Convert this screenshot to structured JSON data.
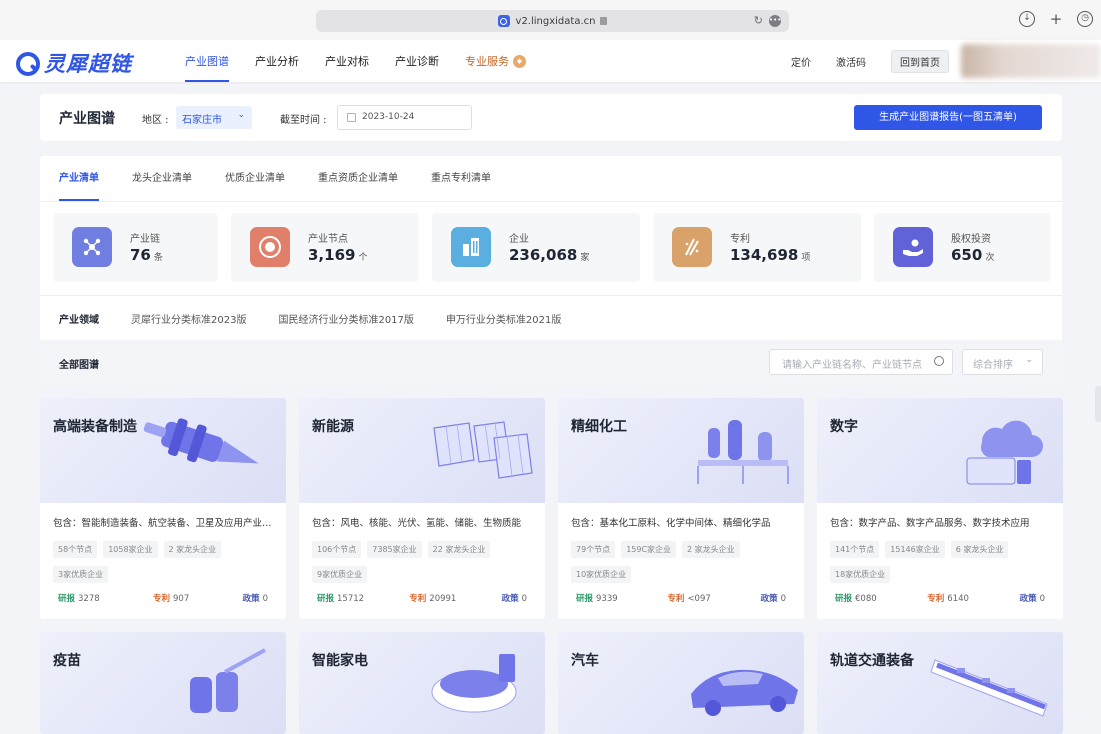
{
  "browser": {
    "url": "v2.lingxidata.cn"
  },
  "header": {
    "logo_text": "灵犀超链",
    "nav": [
      {
        "label": "产业图谱",
        "active": true
      },
      {
        "label": "产业分析"
      },
      {
        "label": "产业对标"
      },
      {
        "label": "产业诊断"
      },
      {
        "label": "专业服务",
        "special": true
      }
    ],
    "right_links": [
      "定价",
      "激活码"
    ],
    "home_button": "回到首页"
  },
  "filter": {
    "title": "产业图谱",
    "region_label": "地区 :",
    "region_value": "石家庄市",
    "date_label": "截至时间 :",
    "date_value": "2023-10-24",
    "generate_button": "生成产业图谱报告(一图五清单)"
  },
  "tabs": [
    "产业清单",
    "龙头企业清单",
    "优质企业清单",
    "重点资质企业清单",
    "重点专利清单"
  ],
  "stats": [
    {
      "label": "产业链",
      "value": "76",
      "unit": "条",
      "icon": "network-icon",
      "color": "#6f7ee0"
    },
    {
      "label": "产业节点",
      "value": "3,169",
      "unit": "个",
      "icon": "target-icon",
      "color": "#e0806a"
    },
    {
      "label": "企业",
      "value": "236,068",
      "unit": "家",
      "icon": "building-icon",
      "color": "#5aaee0"
    },
    {
      "label": "专利",
      "value": "134,698",
      "unit": "项",
      "icon": "patent-icon",
      "color": "#d8a26a"
    },
    {
      "label": "股权投资",
      "value": "650",
      "unit": "次",
      "icon": "investment-icon",
      "color": "#6262d8"
    }
  ],
  "domain_tabs": [
    "产业领域",
    "灵犀行业分类标准2023版",
    "国民经济行业分类标准2017版",
    "申万行业分类标准2021版"
  ],
  "all_bar": {
    "title": "全部图谱",
    "search_placeholder": "请输入产业链名称、产业链节点",
    "sort_label": "综合排序"
  },
  "metric_labels": {
    "research": "研报",
    "patent": "专利",
    "policy": "政策"
  },
  "cards": [
    {
      "name": "高端装备制造",
      "desc": "包含：智能制造装备、航空装备、卫星及应用产业、轨道交通装备、海洋工程装备",
      "tags": [
        "58个节点",
        "1058家企业",
        "2 家龙头企业",
        "3家优质企业"
      ],
      "research": "3278",
      "patent": "907",
      "policy": "0",
      "art": "drill"
    },
    {
      "name": "新能源",
      "desc": "包含：风电、核能、光伏、氢能、储能、生物质能",
      "tags": [
        "106个节点",
        "7385家企业",
        "22 家龙头企业",
        "9家优质企业"
      ],
      "research": "15712",
      "patent": "20991",
      "policy": "0",
      "art": "solar"
    },
    {
      "name": "精细化工",
      "desc": "包含：基本化工原料、化学中间体、精细化学品",
      "tags": [
        "79个节点",
        "159C家企业",
        "2 家龙头企业",
        "10家优质企业"
      ],
      "research": "9339",
      "patent": "<097",
      "policy": "0",
      "art": "chem"
    },
    {
      "name": "数字",
      "desc": "包含：数字产品、数字产品服务、数字技术应用",
      "tags": [
        "141个节点",
        "15146家企业",
        "6 家龙头企业",
        "18家优质企业"
      ],
      "research": "€080",
      "patent": "6140",
      "policy": "0",
      "art": "cloud"
    },
    {
      "name": "疫苗",
      "art": "vaccine"
    },
    {
      "name": "智能家电",
      "art": "robot"
    },
    {
      "name": "汽车",
      "art": "car"
    },
    {
      "name": "轨道交通装备",
      "art": "train"
    }
  ]
}
